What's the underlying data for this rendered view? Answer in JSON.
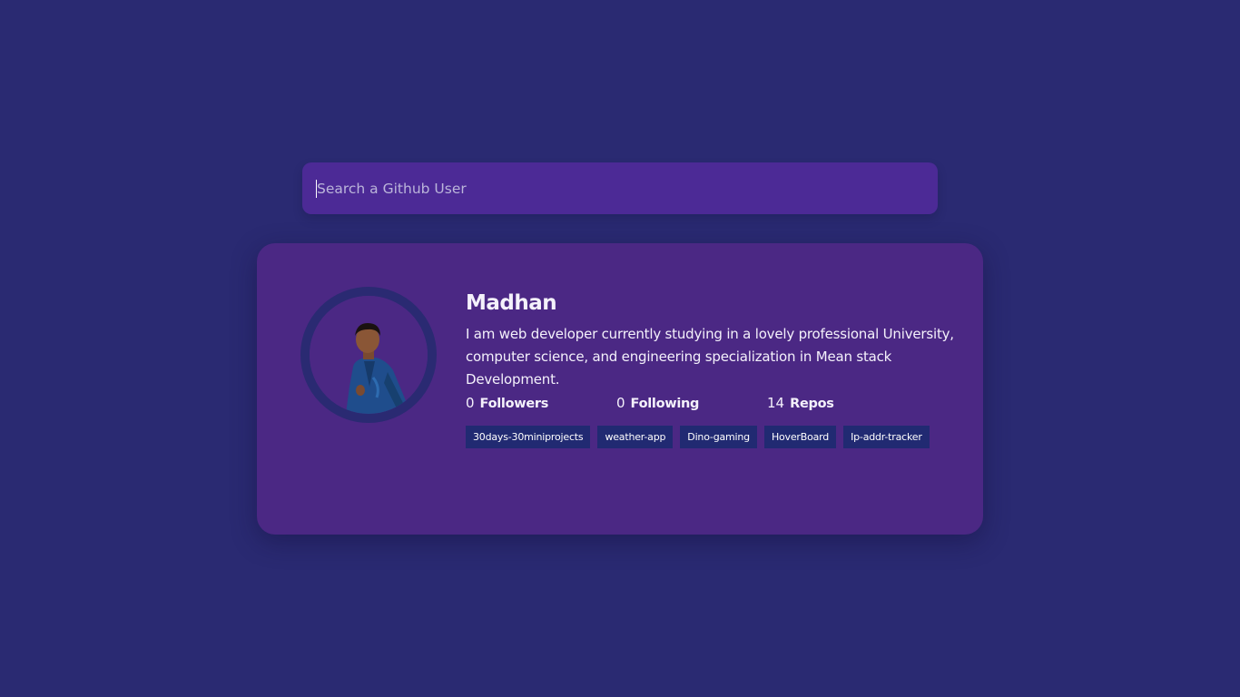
{
  "search": {
    "placeholder": "Search a Github User"
  },
  "profile": {
    "name": "Madhan",
    "bio": "I am web developer currently studying in a lovely professional University, computer science, and engineering specialization in Mean stack Development.",
    "stats": [
      {
        "value": "0",
        "label": "Followers"
      },
      {
        "value": "0",
        "label": "Following"
      },
      {
        "value": "14",
        "label": "Repos"
      }
    ],
    "repos": [
      "30days-30miniprojects",
      "weather-app",
      "Dino-gaming",
      "HoverBoard",
      "Ip-addr-tracker"
    ]
  },
  "colors": {
    "background": "#2a2a72",
    "search_bg": "#4c2a96",
    "card_bg": "#4b2884",
    "repo_bg": "#212a72"
  }
}
